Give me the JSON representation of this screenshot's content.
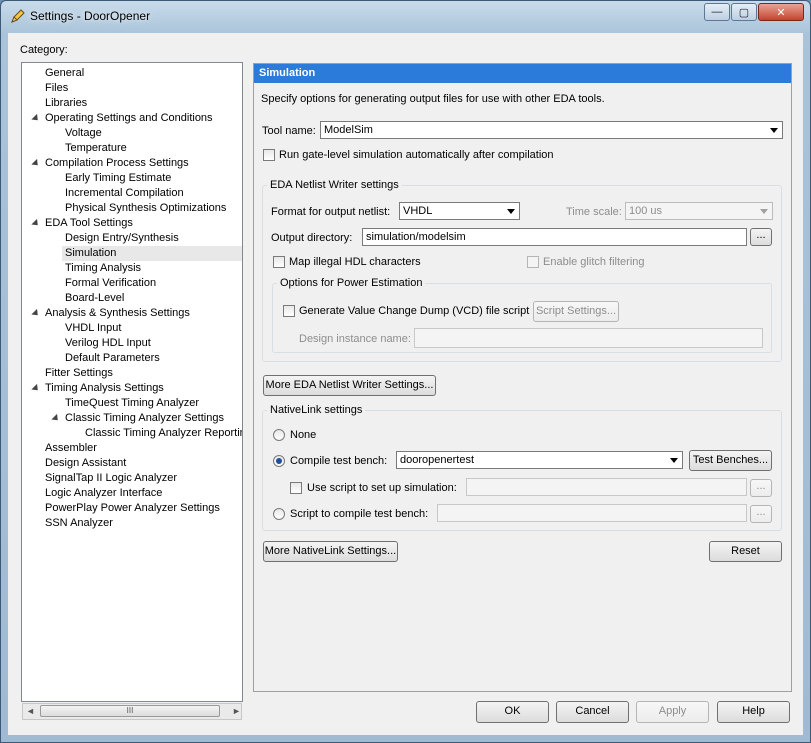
{
  "window": {
    "title": "Settings - DoorOpener",
    "minimize_glyph": "—",
    "maximize_glyph": "▢",
    "close_glyph": "✕"
  },
  "category_label": "Category:",
  "tree": {
    "items": [
      {
        "label": "General",
        "level": 0,
        "expanded": null
      },
      {
        "label": "Files",
        "level": 0,
        "expanded": null
      },
      {
        "label": "Libraries",
        "level": 0,
        "expanded": null
      },
      {
        "label": "Operating Settings and Conditions",
        "level": 0,
        "expanded": true
      },
      {
        "label": "Voltage",
        "level": 1,
        "expanded": null
      },
      {
        "label": "Temperature",
        "level": 1,
        "expanded": null
      },
      {
        "label": "Compilation Process Settings",
        "level": 0,
        "expanded": true
      },
      {
        "label": "Early Timing Estimate",
        "level": 1,
        "expanded": null
      },
      {
        "label": "Incremental Compilation",
        "level": 1,
        "expanded": null
      },
      {
        "label": "Physical Synthesis Optimizations",
        "level": 1,
        "expanded": null
      },
      {
        "label": "EDA Tool Settings",
        "level": 0,
        "expanded": true
      },
      {
        "label": "Design Entry/Synthesis",
        "level": 1,
        "expanded": null
      },
      {
        "label": "Simulation",
        "level": 1,
        "expanded": null,
        "selected": true
      },
      {
        "label": "Timing Analysis",
        "level": 1,
        "expanded": null
      },
      {
        "label": "Formal Verification",
        "level": 1,
        "expanded": null
      },
      {
        "label": "Board-Level",
        "level": 1,
        "expanded": null
      },
      {
        "label": "Analysis & Synthesis Settings",
        "level": 0,
        "expanded": true
      },
      {
        "label": "VHDL Input",
        "level": 1,
        "expanded": null
      },
      {
        "label": "Verilog HDL Input",
        "level": 1,
        "expanded": null
      },
      {
        "label": "Default Parameters",
        "level": 1,
        "expanded": null
      },
      {
        "label": "Fitter Settings",
        "level": 0,
        "expanded": null
      },
      {
        "label": "Timing Analysis Settings",
        "level": 0,
        "expanded": true
      },
      {
        "label": "TimeQuest Timing Analyzer",
        "level": 1,
        "expanded": null
      },
      {
        "label": "Classic Timing Analyzer Settings",
        "level": 1,
        "expanded": true
      },
      {
        "label": "Classic Timing Analyzer Reporting",
        "level": 2,
        "expanded": null
      },
      {
        "label": "Assembler",
        "level": 0,
        "expanded": null
      },
      {
        "label": "Design Assistant",
        "level": 0,
        "expanded": null
      },
      {
        "label": "SignalTap II Logic Analyzer",
        "level": 0,
        "expanded": null
      },
      {
        "label": "Logic Analyzer Interface",
        "level": 0,
        "expanded": null
      },
      {
        "label": "PowerPlay Power Analyzer Settings",
        "level": 0,
        "expanded": null
      },
      {
        "label": "SSN Analyzer",
        "level": 0,
        "expanded": null
      }
    ],
    "scroll_thumb_glyph": "III",
    "scroll_left_glyph": "◄",
    "scroll_right_glyph": "►"
  },
  "panel": {
    "header": "Simulation",
    "description": "Specify options for generating output files for use with other EDA tools.",
    "tool_name_label": "Tool name:",
    "tool_name_value": "ModelSim",
    "run_gate_level_label": "Run gate-level simulation automatically after compilation",
    "eda_netlist": {
      "group_title": "EDA Netlist Writer settings",
      "format_label": "Format for output netlist:",
      "format_value": "VHDL",
      "time_scale_label": "Time scale:",
      "time_scale_value": "100 us",
      "output_dir_label": "Output directory:",
      "output_dir_value": "simulation/modelsim",
      "browse_label": "...",
      "map_illegal_label": "Map illegal HDL characters",
      "enable_glitch_label": "Enable glitch filtering",
      "power": {
        "group_title": "Options for Power Estimation",
        "vcd_label": "Generate Value Change Dump (VCD) file script",
        "script_settings_label": "Script Settings...",
        "design_instance_label": "Design instance name:",
        "design_instance_value": ""
      }
    },
    "more_eda_button": "More EDA Netlist Writer Settings...",
    "nativelink": {
      "group_title": "NativeLink settings",
      "none_label": "None",
      "compile_tb_label": "Compile test bench:",
      "compile_tb_value": "dooropenertest",
      "test_benches_button": "Test Benches...",
      "use_script_label": "Use script to set up simulation:",
      "use_script_value": "",
      "script_compile_label": "Script to compile test bench:",
      "script_compile_value": "",
      "browse_label": "..."
    },
    "more_nativelink_button": "More NativeLink Settings...",
    "reset_button": "Reset"
  },
  "footer": {
    "ok": "OK",
    "cancel": "Cancel",
    "apply": "Apply",
    "help": "Help"
  }
}
